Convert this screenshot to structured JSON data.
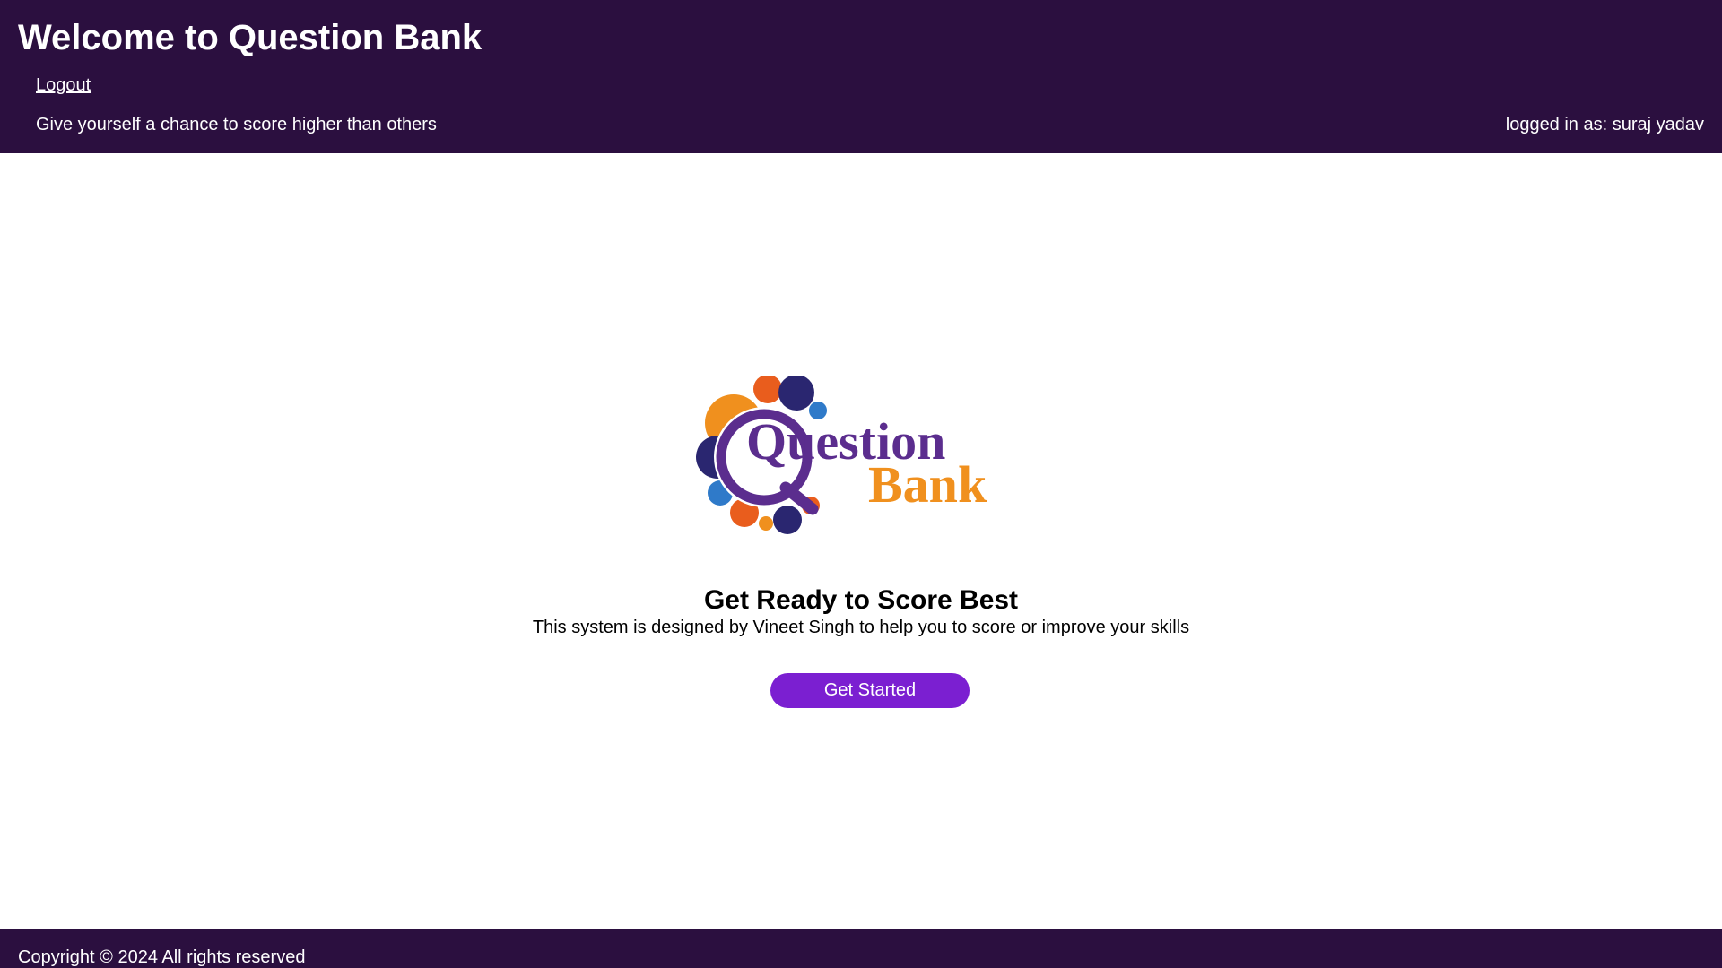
{
  "header": {
    "title": "Welcome to Question Bank",
    "logout_label": "Logout",
    "tagline": "Give yourself a chance to score higher than others",
    "logged_in_text": "logged in as: suraj yadav"
  },
  "logo": {
    "word1": "Question",
    "word2": "Bank",
    "colors": {
      "purple": "#5b2d8e",
      "orange": "#f0901e",
      "navy": "#2a2670",
      "red_orange": "#e95d1d",
      "blue": "#2f7ac9"
    }
  },
  "main": {
    "headline": "Get Ready to Score Best",
    "description": "This system is designed by Vineet Singh to help you to score or improve your skills",
    "cta_label": "Get Started"
  },
  "footer": {
    "copyright": "Copyright © 2024 All rights reserved"
  },
  "theme": {
    "header_bg": "#2b0f3f",
    "button_bg": "#7b1fd1"
  }
}
